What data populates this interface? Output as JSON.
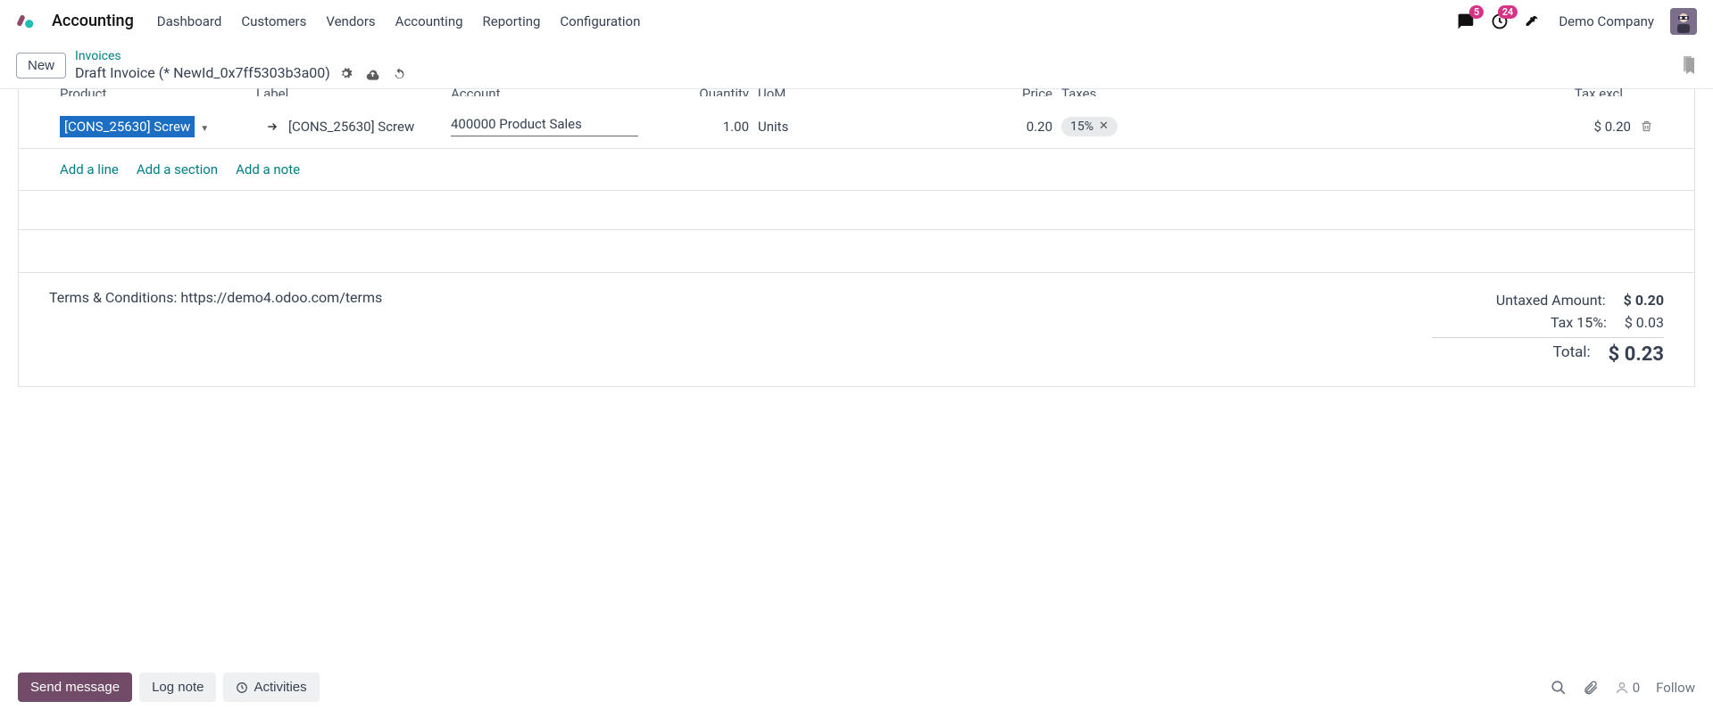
{
  "navbar": {
    "app_name": "Accounting",
    "menu": [
      "Dashboard",
      "Customers",
      "Vendors",
      "Accounting",
      "Reporting",
      "Configuration"
    ],
    "messages_badge": "5",
    "activities_badge": "24",
    "company": "Demo Company"
  },
  "breadcrumb": {
    "new_label": "New",
    "parent": "Invoices",
    "current": "Draft Invoice (* NewId_0x7ff5303b3a00)"
  },
  "table": {
    "headers": {
      "product": "Product",
      "label": "Label",
      "account": "Account",
      "quantity": "Quantity",
      "uom": "UoM",
      "price": "Price",
      "taxes": "Taxes",
      "tax_excl": "Tax excl."
    },
    "line": {
      "product": "[CONS_25630] Screw",
      "label": "[CONS_25630] Screw",
      "account": "400000 Product Sales",
      "quantity": "1.00",
      "uom": "Units",
      "price": "0.20",
      "tax": "15%",
      "tax_excl": "$ 0.20"
    },
    "add_line": "Add a line",
    "add_section": "Add a section",
    "add_note": "Add a note"
  },
  "terms": "Terms & Conditions: https://demo4.odoo.com/terms",
  "totals": {
    "untaxed_label": "Untaxed Amount:",
    "untaxed_value": "$ 0.20",
    "tax_label": "Tax 15%:",
    "tax_value": "$ 0.03",
    "total_label": "Total:",
    "total_value": "$ 0.23"
  },
  "chatter": {
    "send": "Send message",
    "log": "Log note",
    "activities": "Activities",
    "follower_count": "0",
    "follow": "Follow"
  }
}
